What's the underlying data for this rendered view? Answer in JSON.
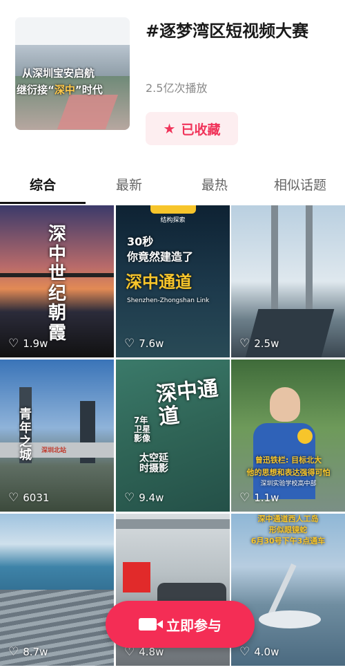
{
  "topic": {
    "title": "#逐梦湾区短视频大赛",
    "plays": "2.5亿次播放",
    "favorite_label": "已收藏",
    "favorite_icon": "star-icon",
    "cover_line1": "从深圳宝安启航",
    "cover_line2_a": "继衍接“",
    "cover_line2_hl": "深中",
    "cover_line2_b": "”时代"
  },
  "tabs": [
    "综合",
    "最新",
    "最热",
    "相似话题"
  ],
  "active_tab": 0,
  "videos": [
    {
      "text": "深中世纪朝霞",
      "likes": "1.9w"
    },
    {
      "badge": "结构探索",
      "t1": "30秒",
      "t2": "你竟然建造了",
      "t3": "深中通道",
      "t4": "Shenzhen-Zhongshan Link",
      "likes": "7.6w"
    },
    {
      "likes": "2.5w"
    },
    {
      "text": "青年之城",
      "sign": "深圳北站",
      "likes": "6031"
    },
    {
      "big": "深中通道",
      "sub1": "7年卫星影像",
      "sub2": "太空延时摄影",
      "likes": "9.4w"
    },
    {
      "cap1": "曾迅铁栏: 目标北大",
      "cap2": "他的思想和表达强得可怕",
      "cap3": "深圳实验学校高中部",
      "likes": "1.1w"
    },
    {
      "likes": "8.7w"
    },
    {
      "likes": "4.8w"
    },
    {
      "top1": "深中通道西人工岛",
      "top2": "形似眼镜蛇",
      "top3": "6月30号下午3点通车",
      "likes": "4.0w"
    }
  ],
  "join_button": {
    "label": "立即参与",
    "icon": "video-camera-icon"
  },
  "colors": {
    "accent": "#f42d55",
    "favorite_bg": "#fdeef0",
    "favorite_text": "#f0345a"
  }
}
